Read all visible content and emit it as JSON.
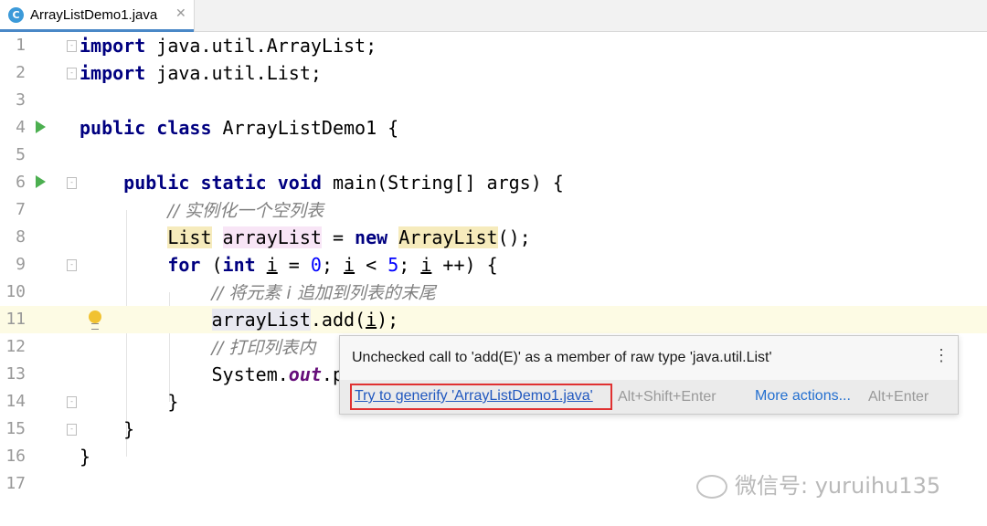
{
  "tab": {
    "icon_letter": "C",
    "title": "ArrayListDemo1.java",
    "close_symbol": "✕"
  },
  "lines": [
    {
      "n": "1",
      "code": "import java.util.ArrayList;"
    },
    {
      "n": "2",
      "code": "import java.util.List;"
    },
    {
      "n": "3",
      "code": ""
    },
    {
      "n": "4",
      "code": "public class ArrayListDemo1 {"
    },
    {
      "n": "5",
      "code": ""
    },
    {
      "n": "6",
      "code": "    public static void main(String[] args) {"
    },
    {
      "n": "7",
      "code": "        // 实例化一个空列表"
    },
    {
      "n": "8",
      "code": "        List arrayList = new ArrayList();"
    },
    {
      "n": "9",
      "code": "        for (int i = 0; i < 5; i ++) {"
    },
    {
      "n": "10",
      "code": "            // 将元素 i 追加到列表的末尾"
    },
    {
      "n": "11",
      "code": "            arrayList.add(i);"
    },
    {
      "n": "12",
      "code": "            // 打印列表内"
    },
    {
      "n": "13",
      "code": "            System.out.p"
    },
    {
      "n": "14",
      "code": "        }"
    },
    {
      "n": "15",
      "code": "    }"
    },
    {
      "n": "16",
      "code": "}"
    },
    {
      "n": "17",
      "code": ""
    }
  ],
  "popup": {
    "message": "Unchecked call to 'add(E)' as a member of raw type 'java.util.List'",
    "more_icon": "⋮",
    "fix_label": "Try to generify 'ArrayListDemo1.java'",
    "fix_shortcut": "Alt+Shift+Enter",
    "more_actions_label": "More actions...",
    "more_actions_shortcut": "Alt+Enter"
  },
  "watermark": {
    "text": "微信号: yuruihu135"
  },
  "colors": {
    "keyword": "#000080",
    "number": "#0000ff",
    "comment": "#808080",
    "current_line": "#fdfbe4",
    "warning_highlight": "#f6ebbc",
    "popup_link": "#2158bf",
    "fix_border": "#e03131"
  },
  "icons": {
    "file_icon": "java-class-icon",
    "run_icon": "run-gutter-icon",
    "bulb_icon": "intention-bulb-icon",
    "fold_icon": "fold-marker-icon"
  }
}
